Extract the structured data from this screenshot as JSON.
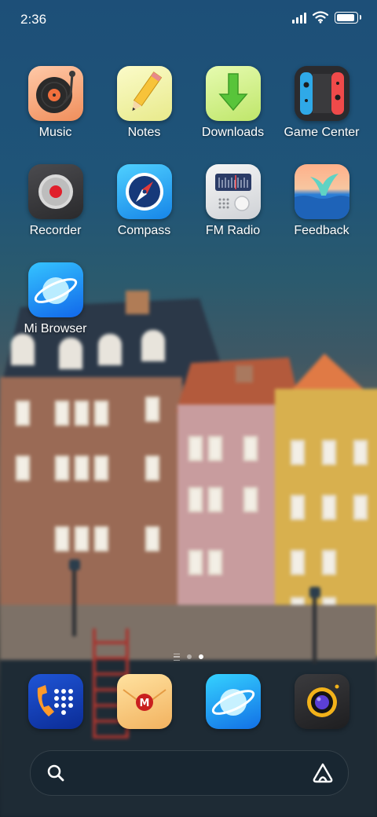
{
  "status_bar": {
    "time": "2:36",
    "battery_level": 0.9,
    "signal_bars": 4
  },
  "apps": [
    {
      "label": "Music",
      "icon": "music-icon"
    },
    {
      "label": "Notes",
      "icon": "notes-icon"
    },
    {
      "label": "Downloads",
      "icon": "downloads-icon"
    },
    {
      "label": "Game Center",
      "icon": "game-center-icon"
    },
    {
      "label": "Recorder",
      "icon": "recorder-icon"
    },
    {
      "label": "Compass",
      "icon": "compass-icon"
    },
    {
      "label": "FM Radio",
      "icon": "fm-radio-icon"
    },
    {
      "label": "Feedback",
      "icon": "feedback-icon"
    },
    {
      "label": "Mi Browser",
      "icon": "browser-icon"
    }
  ],
  "dock": [
    {
      "icon": "phone-icon"
    },
    {
      "icon": "mail-icon"
    },
    {
      "icon": "browser-icon"
    },
    {
      "icon": "camera-icon"
    }
  ],
  "pager": {
    "pages": 2,
    "current": 2
  },
  "search_bar": {
    "icon": "search-icon",
    "assistant_icon": "assistant-icon"
  }
}
